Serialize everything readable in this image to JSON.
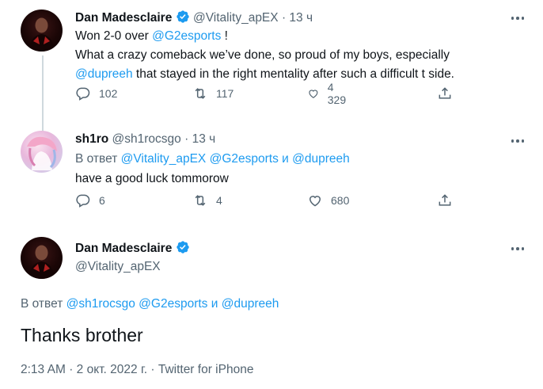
{
  "tweet1": {
    "author_name": "Dan Madesclaire",
    "handle": "@Vitality_apEX",
    "separator": "·",
    "time": "13 ч",
    "line1_prefix": "Won 2-0 over ",
    "line1_mention": "@G2esports",
    "line1_suffix": " !",
    "line2": "What a crazy comeback we’ve done, so proud of my boys, especially",
    "line3_mention": "@dupreeh",
    "line3_suffix": " that stayed in the right mentality after such a difficult t side.",
    "replies": "102",
    "retweets": "117",
    "likes": "4 329"
  },
  "tweet2": {
    "author_name": "sh1ro",
    "handle": "@sh1rocsgo",
    "separator": "·",
    "time": "13 ч",
    "reply_to_label": "В ответ",
    "reply_to_mention1": "@Vitality_apEX",
    "reply_to_mention2": "@G2esports",
    "reply_to_and": "и",
    "reply_to_mention3": "@dupreeh",
    "text": "have a good luck tommorow",
    "replies": "6",
    "retweets": "4",
    "likes": "680"
  },
  "tweet3": {
    "author_name": "Dan Madesclaire",
    "handle": "@Vitality_apEX",
    "reply_to_label": "В ответ",
    "reply_to_mention1": "@sh1rocsgo",
    "reply_to_mention2": "@G2esports",
    "reply_to_and": "и",
    "reply_to_mention3": "@dupreeh",
    "text": "Thanks brother",
    "time": "2:13 AM",
    "date": "2 окт. 2022 г.",
    "source": "Twitter for iPhone",
    "meta_separator": "·"
  },
  "icons": {
    "verified": "verified-badge-icon",
    "reply": "reply-icon",
    "retweet": "retweet-icon",
    "like": "heart-icon",
    "share": "share-icon",
    "more": "more-dots-icon"
  },
  "colors": {
    "link": "#1d9bf0",
    "muted": "#536471",
    "text": "#0f1419",
    "thread_line": "#cfd9de"
  }
}
